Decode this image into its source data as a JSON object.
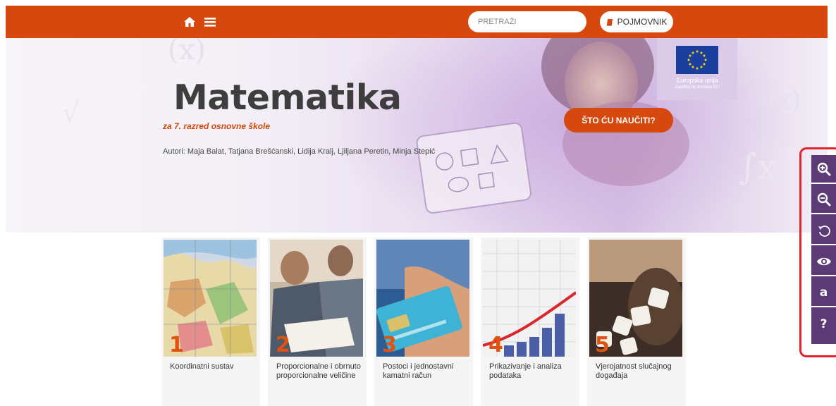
{
  "header": {
    "home_icon": "home-icon",
    "menu_icon": "hamburger-menu-icon",
    "search": {
      "placeholder": "PRETRAŽI",
      "value": ""
    },
    "glossary_label": "POJMOVNIK",
    "glossary_icon": "book-icon",
    "colors": {
      "bar": "#d6480d"
    }
  },
  "hero": {
    "title": "Matematika",
    "subtitle": "za 7. razred osnovne škole",
    "authors": "Autori: Maja Balat, Tatjana Brešćanski, Lidija Kralj, Ljiljana Peretin, Minja Stepić",
    "cta_label": "ŠTO ĆU NAUČITI?",
    "eu": {
      "line1": "Europska unija",
      "line2": "Zajedno do fondova EU"
    }
  },
  "chapters": [
    {
      "number": "1",
      "title": "Koordinatni sustav"
    },
    {
      "number": "2",
      "title": "Proporcionalne i obrnuto proporcionalne veličine"
    },
    {
      "number": "3",
      "title": "Postoci i jednostavni kamatni račun"
    },
    {
      "number": "4",
      "title": "Prikazivanje i analiza podataka"
    },
    {
      "number": "5",
      "title": "Vjerojatnost slučajnog događaja"
    }
  ],
  "accessibility_toolbar": {
    "items": [
      {
        "icon": "zoom-in-icon"
      },
      {
        "icon": "zoom-out-icon"
      },
      {
        "icon": "reset-icon"
      },
      {
        "icon": "eye-icon"
      },
      {
        "icon": "font-icon",
        "text": "a"
      },
      {
        "icon": "help-icon",
        "text": "?"
      }
    ]
  }
}
